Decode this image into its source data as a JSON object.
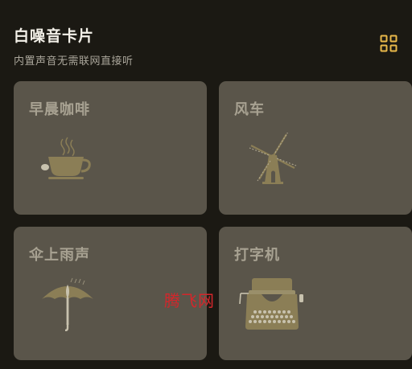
{
  "header": {
    "title": "白噪音卡片",
    "subtitle": "内置声音无需联网直接听"
  },
  "cards": [
    {
      "label": "早晨咖啡",
      "icon": "coffee-cup-icon"
    },
    {
      "label": "风车",
      "icon": "windmill-icon"
    },
    {
      "label": "伞上雨声",
      "icon": "umbrella-icon"
    },
    {
      "label": "打字机",
      "icon": "typewriter-icon"
    }
  ],
  "watermark": "腾飞网",
  "colors": {
    "background": "#1b1913",
    "card": "#5a554a",
    "card_label": "#a8a292",
    "icon": "#8b7e56",
    "accent": "#e8b84a",
    "watermark": "#d4262b"
  }
}
